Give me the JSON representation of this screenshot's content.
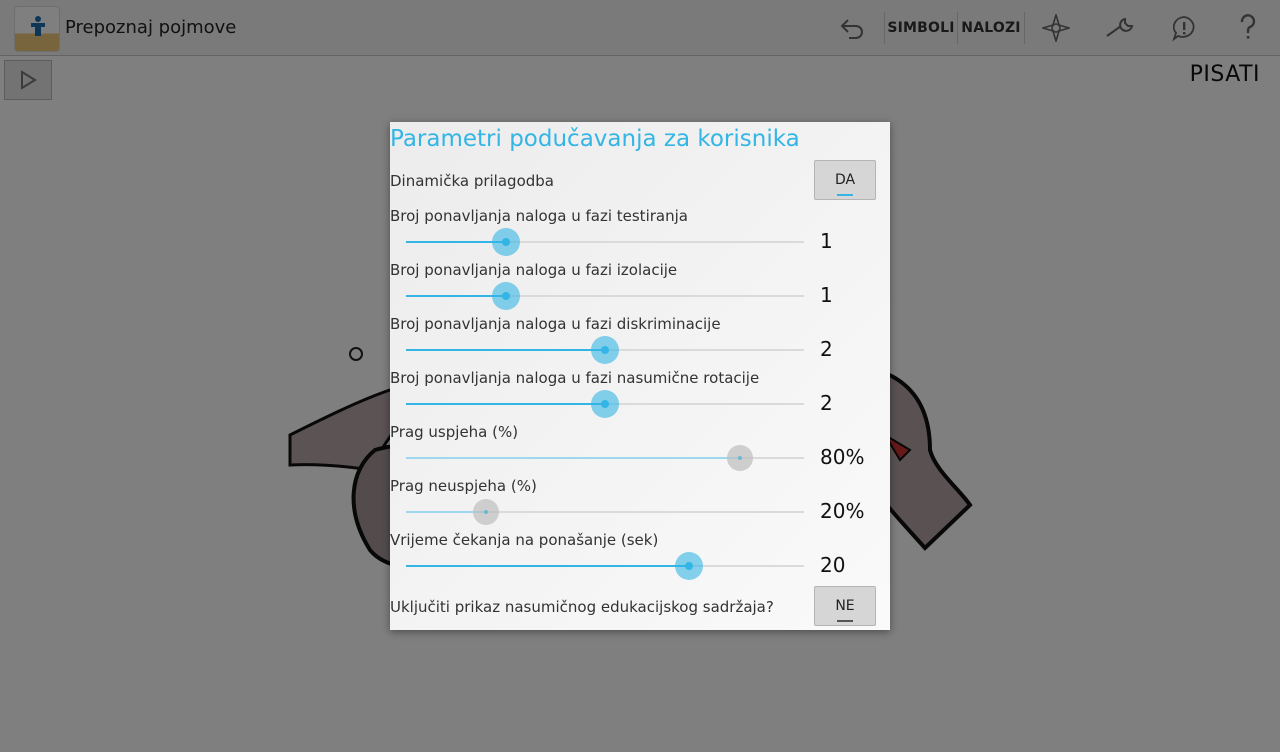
{
  "app": {
    "title": "Prepoznaj pojmove"
  },
  "toolbar": {
    "undo_icon": "undo-icon",
    "symbols_label": "SIMBOLI",
    "tasks_label": "NALOZI",
    "compass_icon": "compass-icon",
    "wrench_icon": "wrench-icon",
    "alert_icon": "alert-bubble-icon",
    "help_icon": "help-icon"
  },
  "content": {
    "mode_label": "PISATI",
    "play_icon": "play-icon"
  },
  "dialog": {
    "title": "Parametri podučavanja za korisnika",
    "dynamic_label": "Dinamička prilagodba",
    "dynamic_value": "DA",
    "random_label": "Uključiti prikaz nasumičnog edukacijskog sadržaja?",
    "random_value": "NE",
    "sliders": [
      {
        "label": "Broj ponavljanja naloga u fazi testiranja",
        "value": "1",
        "position": 0.25,
        "enabled": true
      },
      {
        "label": "Broj ponavljanja naloga u fazi izolacije",
        "value": "1",
        "position": 0.25,
        "enabled": true
      },
      {
        "label": "Broj ponavljanja naloga u fazi diskriminacije",
        "value": "2",
        "position": 0.5,
        "enabled": true
      },
      {
        "label": "Broj ponavljanja naloga u fazi nasumične rotacije",
        "value": "2",
        "position": 0.5,
        "enabled": true
      },
      {
        "label": "Prag uspjeha (%)",
        "value": "80%",
        "position": 0.84,
        "enabled": false
      },
      {
        "label": "Prag neuspjeha (%)",
        "value": "20%",
        "position": 0.2,
        "enabled": false
      },
      {
        "label": "Vrijeme čekanja na ponašanje (sek)",
        "value": "20",
        "position": 0.71,
        "enabled": true
      }
    ]
  },
  "colors": {
    "accent": "#33b5e5",
    "dim_overlay": "#000000"
  }
}
